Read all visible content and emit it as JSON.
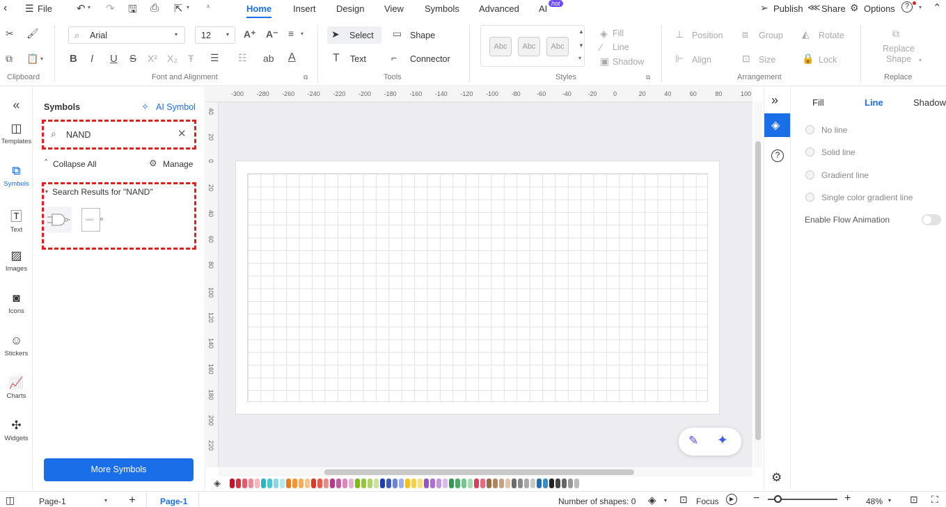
{
  "menubar": {
    "file": "File",
    "tabs": [
      "Home",
      "Insert",
      "Design",
      "View",
      "Symbols",
      "Advanced",
      "AI"
    ],
    "hot": "hot",
    "publish": "Publish",
    "share": "Share",
    "options": "Options"
  },
  "ribbon": {
    "font": "Arial",
    "size": "12",
    "select": "Select",
    "shape": "Shape",
    "text": "Text",
    "connector": "Connector",
    "style_samples": [
      "Abc",
      "Abc",
      "Abc"
    ],
    "fill": "Fill",
    "line": "Line",
    "shadow": "Shadow",
    "position": "Position",
    "group": "Group",
    "rotate": "Rotate",
    "align": "Align",
    "size_btn": "Size",
    "lock": "Lock",
    "replace_shape_1": "Replace",
    "replace_shape_2": "Shape",
    "groups": {
      "clipboard": "Clipboard",
      "font": "Font and Alignment",
      "tools": "Tools",
      "styles": "Styles",
      "arrangement": "Arrangement",
      "replace": "Replace"
    }
  },
  "leftbar": [
    "Templates",
    "Symbols",
    "Text",
    "Images",
    "Icons",
    "Stickers",
    "Charts",
    "Widgets"
  ],
  "panel": {
    "title": "Symbols",
    "ai_symbol": "AI Symbol",
    "search_value": "NAND",
    "collapse": "Collapse All",
    "manage": "Manage",
    "results": "Search Results for  \"NAND\"",
    "more": "More Symbols",
    "thumb_label": "NAND"
  },
  "ruler_h": [
    "-300",
    "-280",
    "-260",
    "-240",
    "-220",
    "-200",
    "-180",
    "-160",
    "-140",
    "-120",
    "-100",
    "-80",
    "-60",
    "-40",
    "-20",
    "0",
    "20",
    "40",
    "60",
    "80",
    "100"
  ],
  "ruler_v": [
    "40",
    "20",
    "0",
    "20",
    "40",
    "60",
    "80",
    "100",
    "120",
    "140",
    "160",
    "180",
    "200",
    "220"
  ],
  "props": {
    "tabs": [
      "Fill",
      "Line",
      "Shadow"
    ],
    "options": [
      "No line",
      "Solid line",
      "Gradient line",
      "Single color gradient line"
    ],
    "flow": "Enable Flow Animation"
  },
  "status": {
    "page_select": "Page-1",
    "page_tab": "Page-1",
    "shapes": "Number of shapes: 0",
    "focus": "Focus",
    "zoom": "48%"
  },
  "colors": {
    "accent": "#1a6fe8",
    "highlight": "#e0201f",
    "palette": [
      "#c0152a",
      "#d9303f",
      "#e85a6a",
      "#f08a95",
      "#f6b7bf",
      "#2ab5c5",
      "#4fc6d3",
      "#87d9e2",
      "#b6e8ee",
      "#f07a1a",
      "#f5952c",
      "#f7ae56",
      "#fac687",
      "#e4352a",
      "#ea5b4f",
      "#f08a80",
      "#b5398d",
      "#c95aa5",
      "#dc86c0",
      "#e9b0d6",
      "#7fb81c",
      "#94c53c",
      "#aed36a",
      "#cbe39b",
      "#1f3fae",
      "#3c5bc3",
      "#6c86d6",
      "#9db0e6",
      "#f2c21a",
      "#f5d247",
      "#f8e07c",
      "#9a52c8",
      "#ad6fd4",
      "#c395e0",
      "#d8b9eb",
      "#2d9a4e",
      "#4aad66",
      "#78c58d",
      "#a8dbb5",
      "#e03d5c",
      "#e8697f",
      "#9a6b45",
      "#b0845d",
      "#c6a283",
      "#ddc5ae",
      "#6d6d6d",
      "#8a8a8a",
      "#a8a8a8",
      "#c9c9c9",
      "#1f6fb5",
      "#3d8ac8",
      "#222222",
      "#444444",
      "#666666",
      "#999999",
      "#bbbbbb"
    ]
  }
}
